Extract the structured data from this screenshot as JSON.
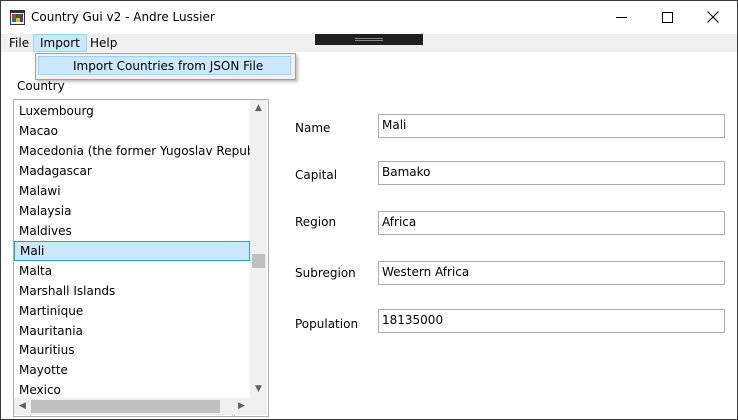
{
  "window": {
    "title": "Country Gui v2 - Andre Lussier",
    "controls": {
      "minimize": "minimize-icon",
      "maximize": "maximize-icon",
      "close": "close-icon"
    }
  },
  "menu": {
    "items": [
      {
        "label": "File"
      },
      {
        "label": "Import",
        "open": true
      },
      {
        "label": "Help"
      }
    ],
    "import_dropdown": {
      "item": "Import Countries from JSON File"
    }
  },
  "country_list": {
    "label": "Country",
    "items": [
      "Luxembourg",
      "Macao",
      "Macedonia (the former Yugoslav Republic of Macedonia)",
      "Madagascar",
      "Malawi",
      "Malaysia",
      "Maldives",
      "Mali",
      "Malta",
      "Marshall Islands",
      "Martinique",
      "Mauritania",
      "Mauritius",
      "Mayotte",
      "Mexico"
    ],
    "selected": "Mali"
  },
  "details": {
    "name_label": "Name",
    "name_value": "Mali",
    "capital_label": "Capital",
    "capital_value": "Bamako",
    "region_label": "Region",
    "region_value": "Africa",
    "subregion_label": "Subregion",
    "subregion_value": "Western Africa",
    "population_label": "Population",
    "population_value": "18135000"
  },
  "colors": {
    "selection_bg": "#cce8ff",
    "selection_border": "#26a0da",
    "menubar_bg": "#f0f0f0",
    "scrollbar_thumb": "#c0c0c0"
  }
}
